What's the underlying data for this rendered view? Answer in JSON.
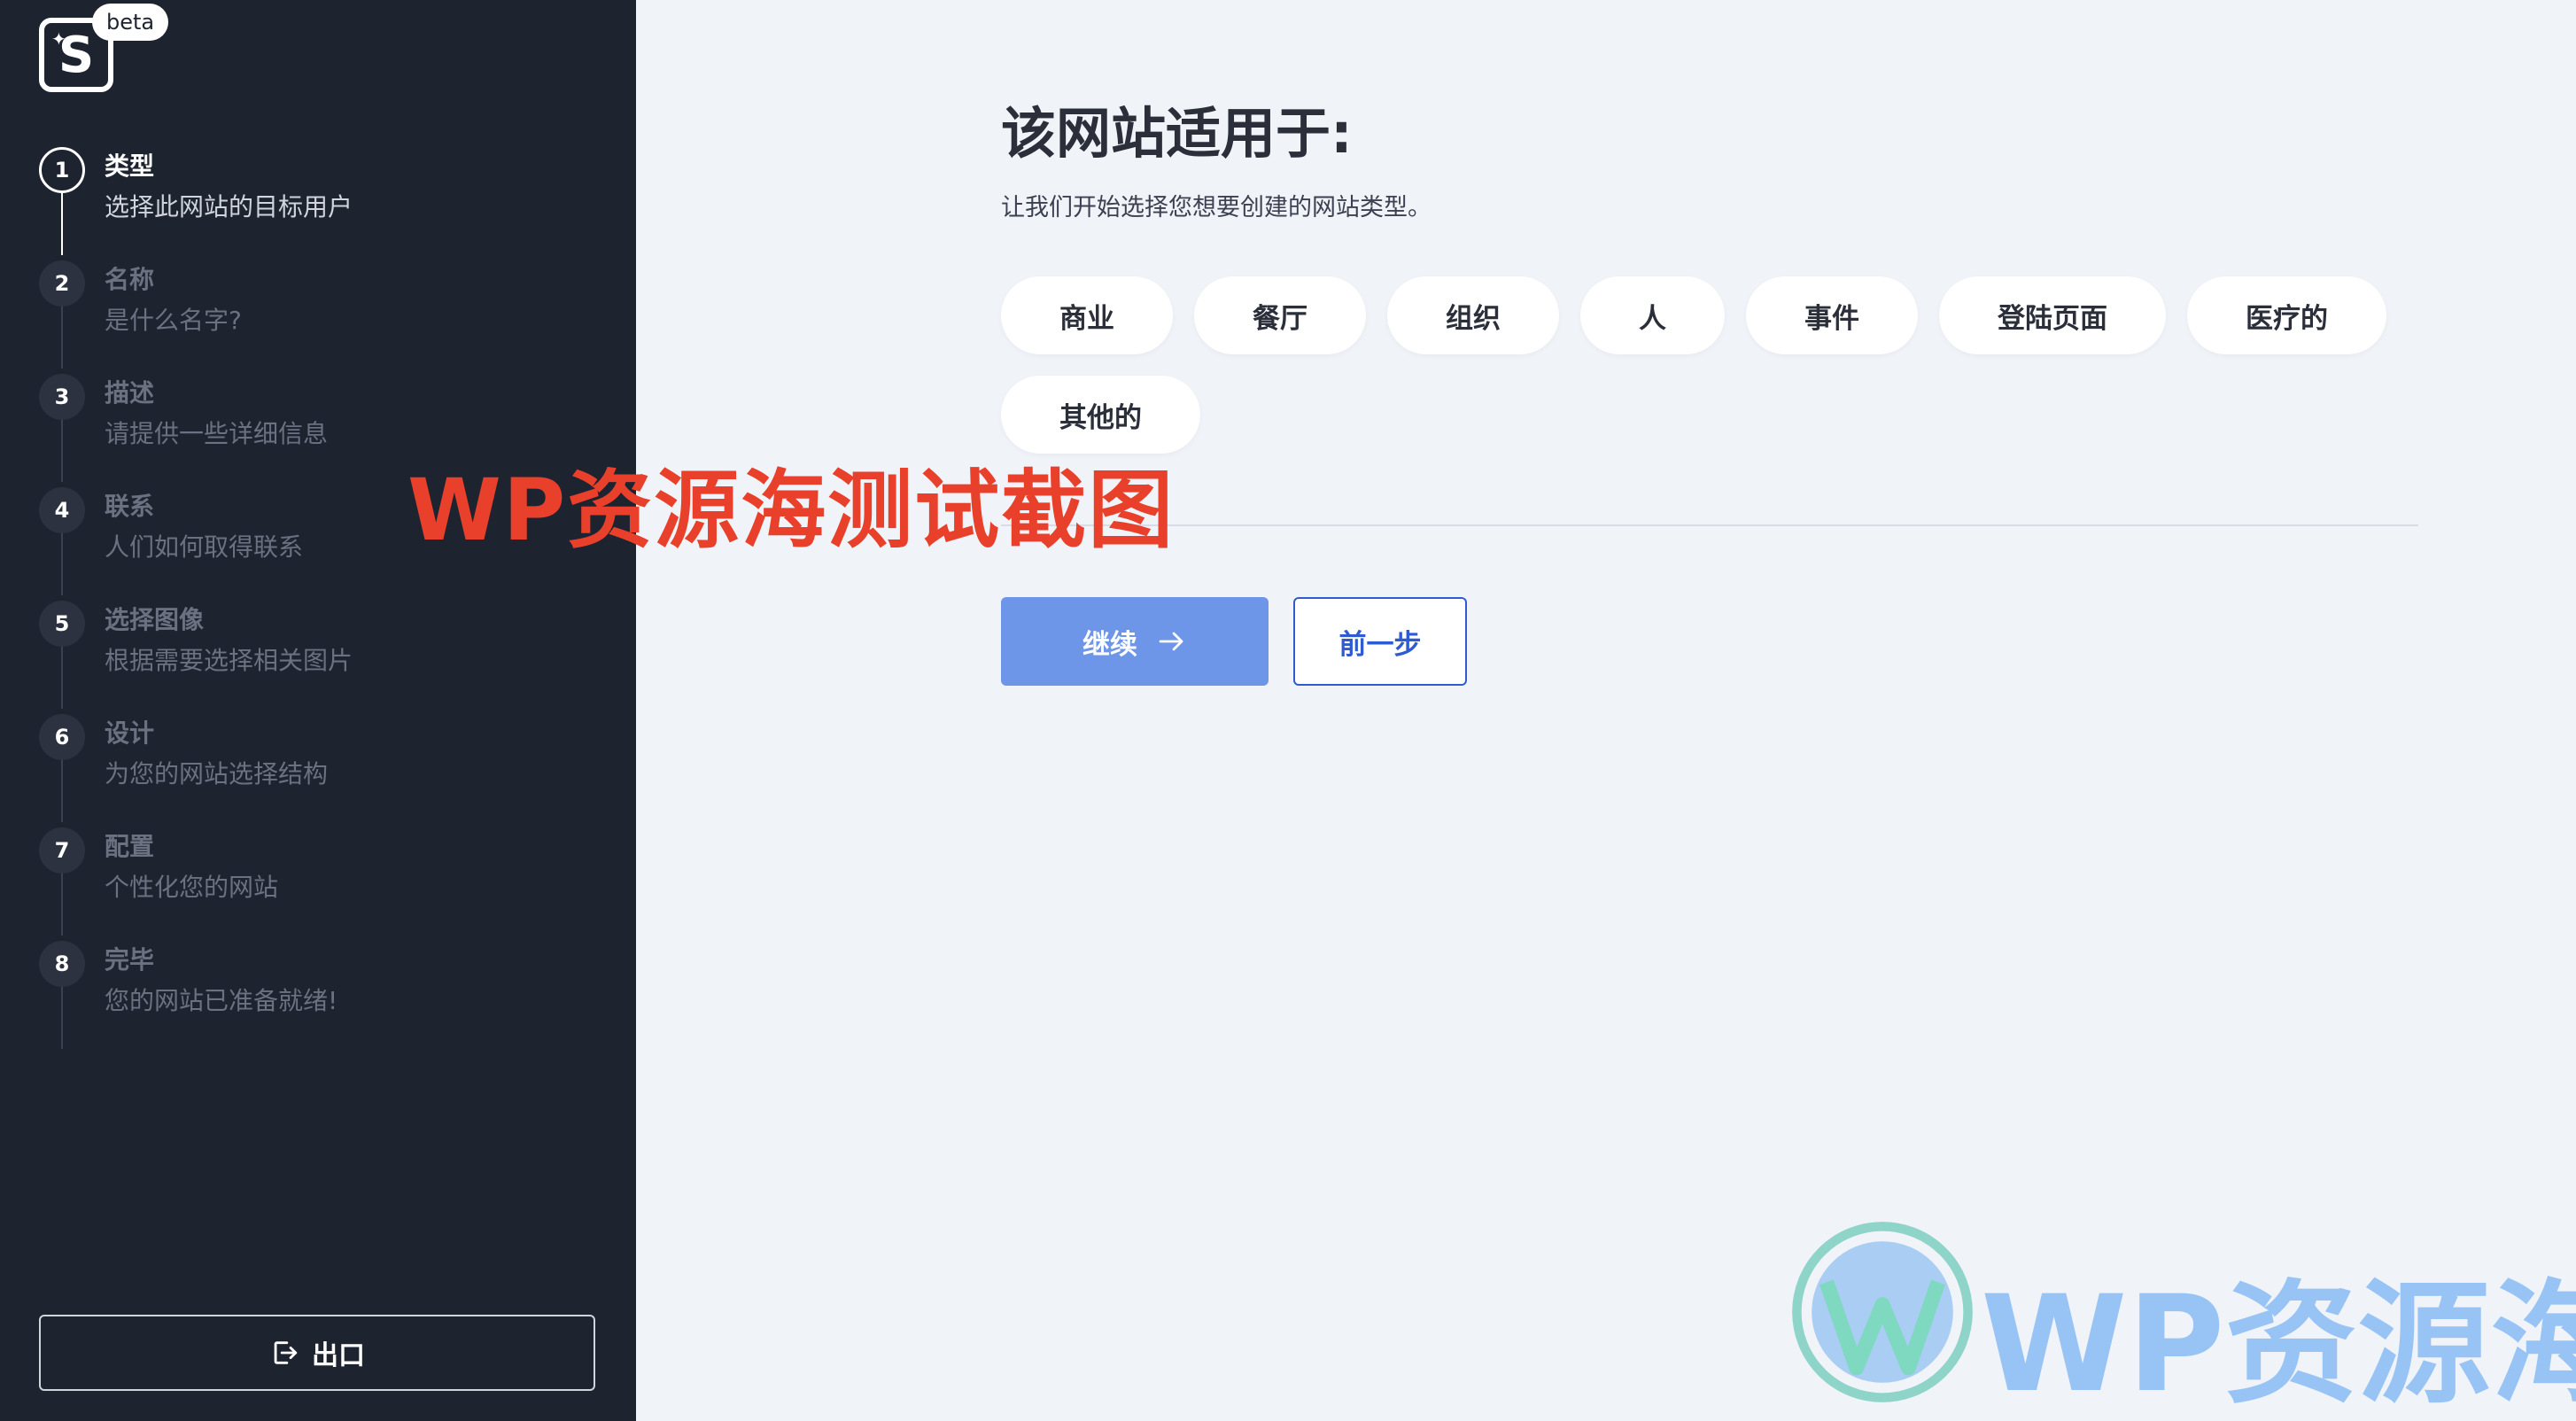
{
  "app": {
    "logo_letter": "S",
    "badge": "beta"
  },
  "steps": [
    {
      "num": "1",
      "title": "类型",
      "subtitle": "选择此网站的目标用户",
      "active": true
    },
    {
      "num": "2",
      "title": "名称",
      "subtitle": "是什么名字?",
      "active": false
    },
    {
      "num": "3",
      "title": "描述",
      "subtitle": "请提供一些详细信息",
      "active": false
    },
    {
      "num": "4",
      "title": "联系",
      "subtitle": "人们如何取得联系",
      "active": false
    },
    {
      "num": "5",
      "title": "选择图像",
      "subtitle": "根据需要选择相关图片",
      "active": false
    },
    {
      "num": "6",
      "title": "设计",
      "subtitle": "为您的网站选择结构",
      "active": false
    },
    {
      "num": "7",
      "title": "配置",
      "subtitle": "个性化您的网站",
      "active": false
    },
    {
      "num": "8",
      "title": "完毕",
      "subtitle": "您的网站已准备就绪!",
      "active": false
    }
  ],
  "sidebar": {
    "exit_label": "出口"
  },
  "main": {
    "title": "该网站适用于:",
    "subtitle": "让我们开始选择您想要创建的网站类型。",
    "choices": [
      "商业",
      "餐厅",
      "组织",
      "人",
      "事件",
      "登陆页面",
      "医疗的",
      "其他的"
    ],
    "continue_label": "继续",
    "prev_label": "前一步"
  },
  "watermark": {
    "overlay_text": "WP资源海测试截图",
    "brand_text": "WP资源海"
  },
  "colors": {
    "sidebar_bg": "#1e2330",
    "page_bg": "#f0f3f8",
    "primary": "#6d95e8",
    "link": "#2e5bd0",
    "watermark_red": "#e8402a"
  }
}
